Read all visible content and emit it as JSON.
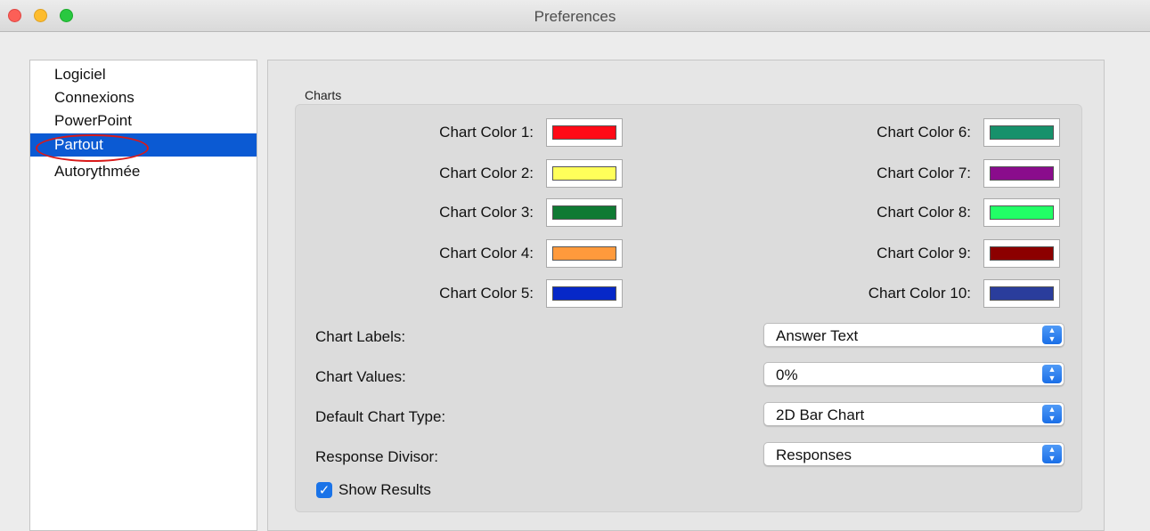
{
  "window": {
    "title": "Preferences"
  },
  "sidebar": {
    "items": [
      {
        "label": "Logiciel"
      },
      {
        "label": "Connexions"
      },
      {
        "label": "PowerPoint"
      },
      {
        "label": "Partout",
        "selected": true
      },
      {
        "label": "Autorythmée"
      }
    ]
  },
  "charts": {
    "group_title": "Charts",
    "colors_left": [
      {
        "label": "Chart Color 1:",
        "color": "#ff0a16"
      },
      {
        "label": "Chart Color 2:",
        "color": "#ffff5a"
      },
      {
        "label": "Chart Color 3:",
        "color": "#0f7a33"
      },
      {
        "label": "Chart Color 4:",
        "color": "#ff9a3c"
      },
      {
        "label": "Chart Color 5:",
        "color": "#0628c8"
      }
    ],
    "colors_right": [
      {
        "label": "Chart Color 6:",
        "color": "#17916b"
      },
      {
        "label": "Chart Color 7:",
        "color": "#8a0c8c"
      },
      {
        "label": "Chart Color 8:",
        "color": "#22ff66"
      },
      {
        "label": "Chart Color 9:",
        "color": "#8c0000"
      },
      {
        "label": "Chart Color 10:",
        "color": "#2a3d9c"
      }
    ],
    "settings": [
      {
        "label": "Chart Labels:",
        "value": "Answer Text"
      },
      {
        "label": "Chart Values:",
        "value": "0%"
      },
      {
        "label": "Default Chart Type:",
        "value": "2D Bar Chart"
      },
      {
        "label": "Response Divisor:",
        "value": "Responses"
      }
    ],
    "show_results": {
      "label": "Show Results",
      "checked": true
    }
  }
}
